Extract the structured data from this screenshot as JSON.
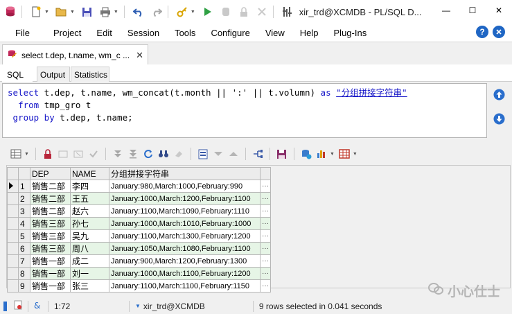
{
  "window": {
    "title": "xir_trd@XCMDB - PL/SQL D...",
    "controls": {
      "minimize": "—",
      "maximize": "☐",
      "close": "✕"
    }
  },
  "menu": {
    "items": [
      "File",
      "Project",
      "Edit",
      "Session",
      "Tools",
      "Configure",
      "View",
      "Help",
      "Plug-Ins"
    ],
    "help_icon": "?"
  },
  "document_tab": {
    "label": "select t.dep, t.name, wm_c ...",
    "close": "✕"
  },
  "sub_tabs": [
    "SQL",
    "Output",
    "Statistics"
  ],
  "sql": {
    "line1": {
      "kw1": "select",
      "rest": " t.dep, t.name, wm_concat(t.month || ':' || t.volumn) ",
      "kw2": "as",
      "alias": "\"分组拼接字符串\""
    },
    "line2": {
      "indent": "  ",
      "kw": "from",
      "rest": " tmp_gro t"
    },
    "line3": {
      "indent": " ",
      "kw": "group by",
      "rest": " t.dep, t.name;"
    }
  },
  "grid": {
    "columns": [
      "DEP",
      "NAME",
      "分组拼接字符串"
    ],
    "rows": [
      {
        "num": "1",
        "dep": "销售二部",
        "name": "李四",
        "grp": "January:980,March:1000,February:990",
        "more": "···"
      },
      {
        "num": "2",
        "dep": "销售二部",
        "name": "王五",
        "grp": "January:1000,March:1200,February:1100",
        "more": "···"
      },
      {
        "num": "3",
        "dep": "销售二部",
        "name": "赵六",
        "grp": "January:1100,March:1090,February:1110",
        "more": "···"
      },
      {
        "num": "4",
        "dep": "销售三部",
        "name": "孙七",
        "grp": "January:1000,March:1010,February:1000",
        "more": "···"
      },
      {
        "num": "5",
        "dep": "销售三部",
        "name": "吴九",
        "grp": "January:1100,March:1300,February:1200",
        "more": "···"
      },
      {
        "num": "6",
        "dep": "销售三部",
        "name": "周八",
        "grp": "January:1050,March:1080,February:1100",
        "more": "···"
      },
      {
        "num": "7",
        "dep": "销售一部",
        "name": "成二",
        "grp": "January:900,March:1200,February:1300",
        "more": "···"
      },
      {
        "num": "8",
        "dep": "销售一部",
        "name": "刘一",
        "grp": "January:1000,March:1100,February:1200",
        "more": "···"
      },
      {
        "num": "9",
        "dep": "销售一部",
        "name": "张三",
        "grp": "January:1100,March:1100,February:1150",
        "more": "···"
      }
    ]
  },
  "status": {
    "cursor": "1:72",
    "connection": "xir_trd@XCMDB",
    "message": "9 rows selected in 0.041 seconds"
  },
  "watermark": "小心仕士",
  "colors": {
    "keyword": "#1515c8",
    "even_row": "#e6f5e6",
    "accent": "#1f66c4"
  }
}
